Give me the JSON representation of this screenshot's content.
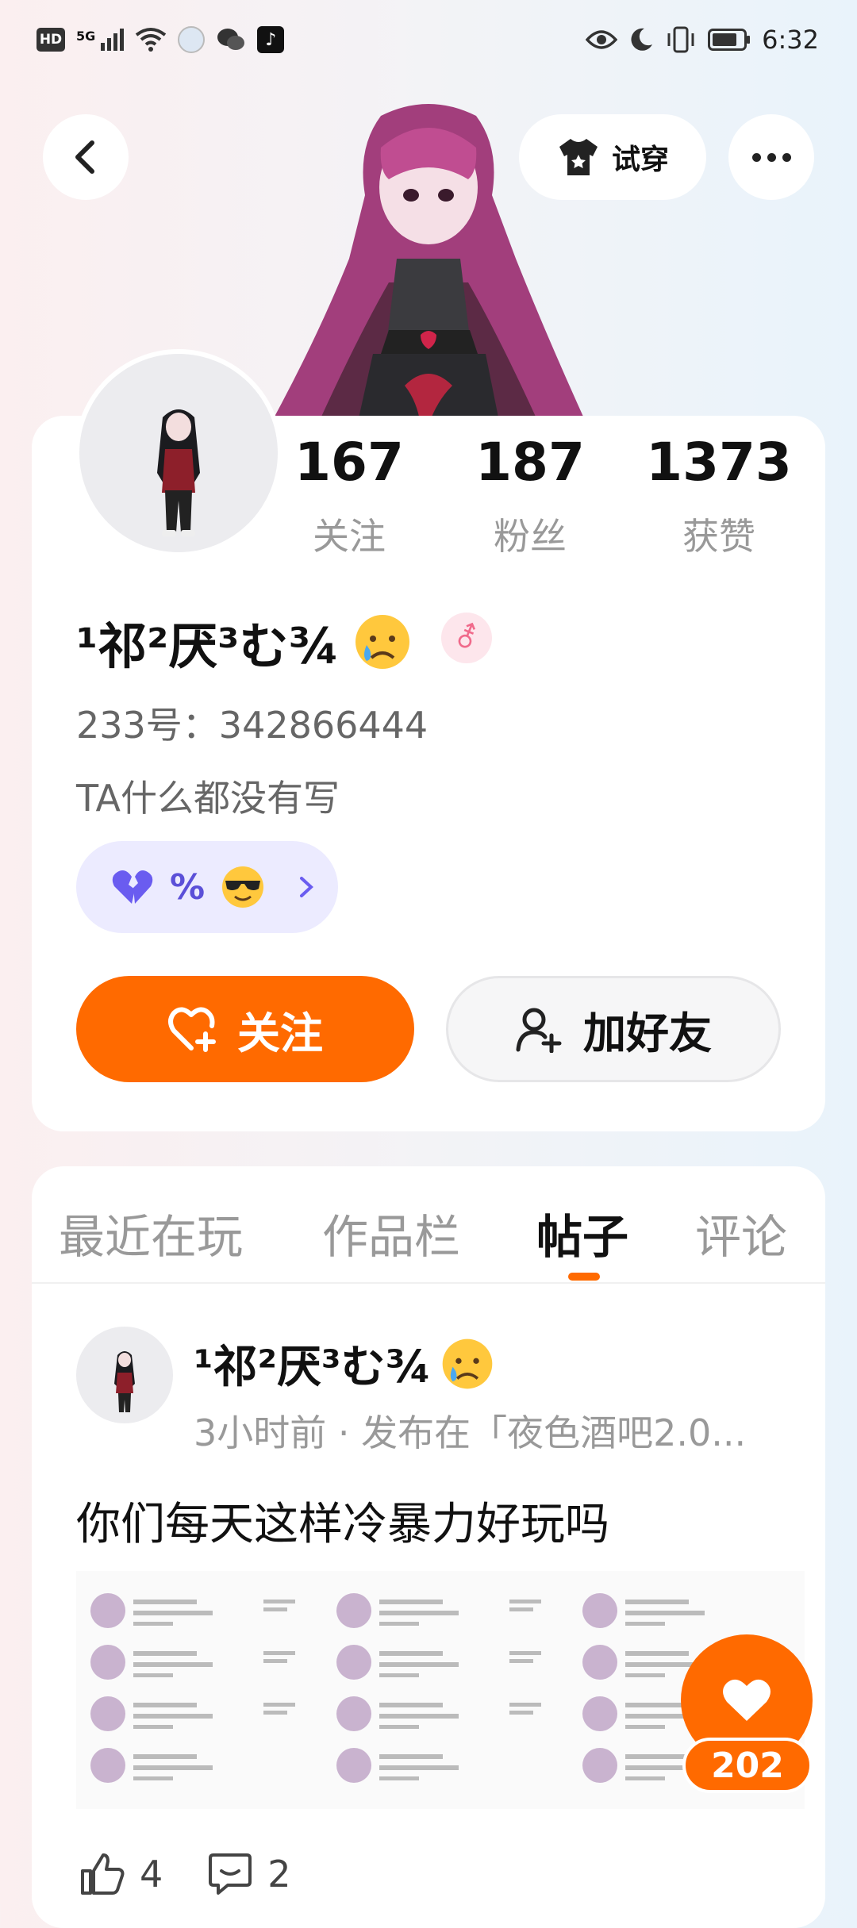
{
  "status_bar": {
    "hd": "HD",
    "signal": "5G",
    "time": "6:32"
  },
  "header": {
    "try_on_label": "试穿"
  },
  "profile": {
    "stats": [
      {
        "value": "167",
        "label": "关注"
      },
      {
        "value": "187",
        "label": "粉丝"
      },
      {
        "value": "1373",
        "label": "获赞"
      }
    ],
    "name": "¹祁²厌³む¾",
    "gender_symbol": "⚦",
    "id_line": "233号：342866444",
    "bio": "TA什么都没有写",
    "tag_text": "%",
    "follow_label": "关注",
    "add_friend_label": "加好友"
  },
  "tabs": [
    {
      "label": "最近在玩",
      "active": false
    },
    {
      "label": "作品栏",
      "active": false
    },
    {
      "label": "帖子",
      "active": true
    },
    {
      "label": "评论",
      "active": false
    }
  ],
  "post": {
    "author": "¹祁²厌³む¾",
    "meta": "3小时前 · 发布在「夜色酒吧2.0...",
    "text": "你们每天这样冷暴力好玩吗",
    "like_fab_count": "202",
    "likes": "4",
    "comments": "2"
  },
  "colors": {
    "accent": "#ff6a00",
    "tag_bg": "#ecebff",
    "tag_fg": "#5b50d8"
  }
}
